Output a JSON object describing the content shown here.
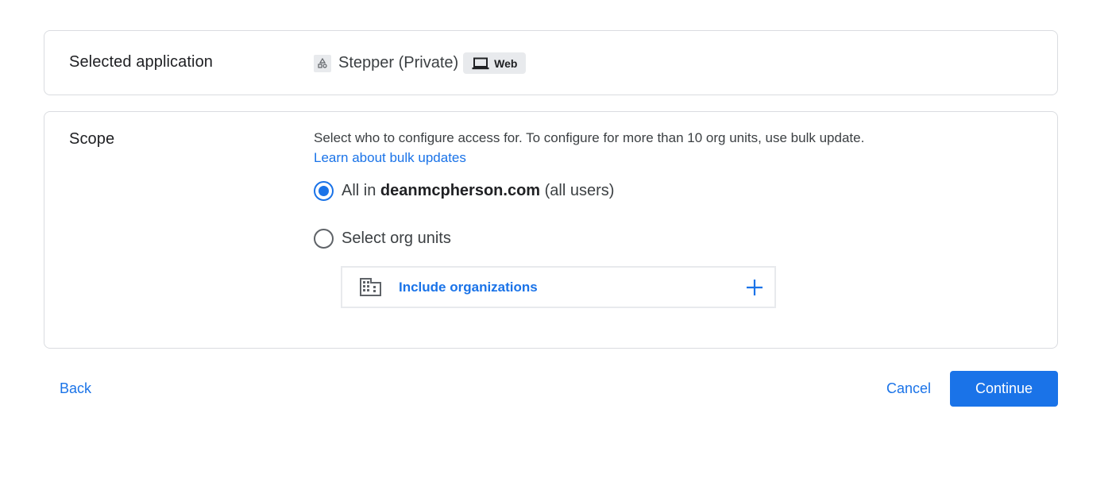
{
  "selected_application": {
    "label": "Selected application",
    "app_name": "Stepper (Private)",
    "app_icon": "app-shapes-icon",
    "platform_chip": {
      "icon": "laptop-icon",
      "label": "Web"
    }
  },
  "scope": {
    "label": "Scope",
    "description": "Select who to configure access for. To configure for more than 10 org units, use bulk update.",
    "link": "Learn about bulk updates",
    "options": [
      {
        "prefix": "All in ",
        "domain": "deanmcpherson.com",
        "suffix": " (all users)",
        "selected": true
      },
      {
        "label": "Select org units",
        "selected": false
      }
    ],
    "include_orgs": {
      "icon": "building-icon",
      "label": "Include organizations",
      "action_icon": "plus-icon"
    }
  },
  "footer": {
    "back": "Back",
    "cancel": "Cancel",
    "continue": "Continue"
  },
  "colors": {
    "accent": "#1a73e8",
    "border": "#dadce0",
    "chip_bg": "#e8eaed"
  }
}
